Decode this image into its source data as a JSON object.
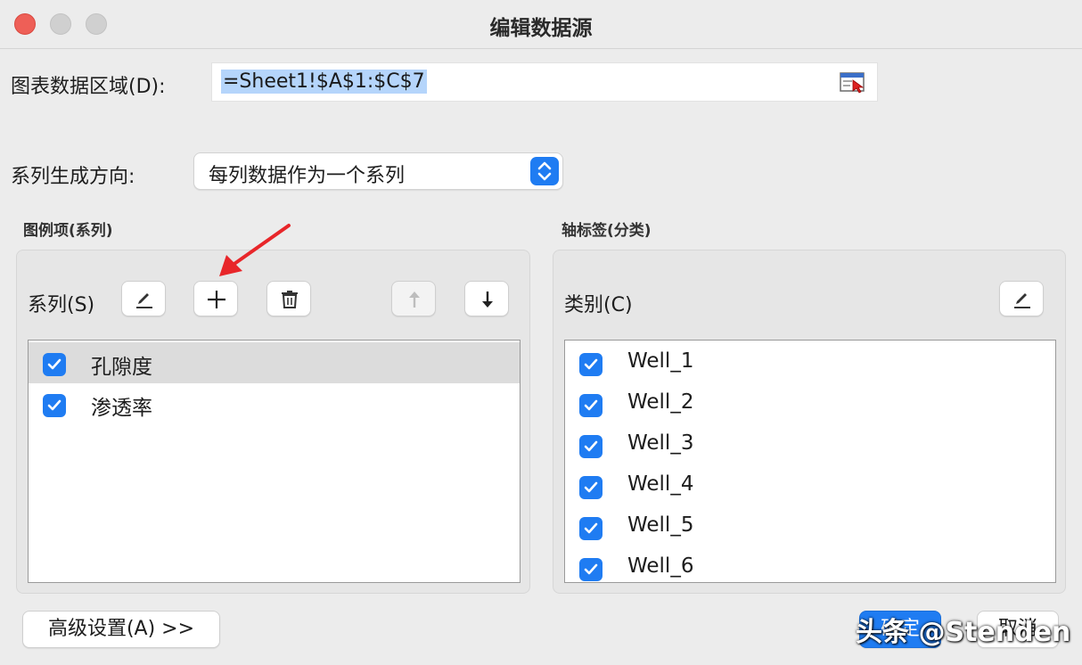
{
  "window": {
    "title": "编辑数据源"
  },
  "data_range": {
    "label": "图表数据区域(D):",
    "value": "=Sheet1!$A$1:$C$7",
    "picker_icon": "range-select-icon"
  },
  "series_direction": {
    "label": "系列生成方向:",
    "selected": "每列数据作为一个系列"
  },
  "legend_section": {
    "title": "图例项(系列)",
    "toolbar_label": "系列(S)",
    "items": [
      {
        "label": "孔隙度",
        "checked": true
      },
      {
        "label": "渗透率",
        "checked": true
      }
    ]
  },
  "axis_section": {
    "title": "轴标签(分类)",
    "toolbar_label": "类别(C)",
    "items": [
      {
        "label": "Well_1",
        "checked": true
      },
      {
        "label": "Well_2",
        "checked": true
      },
      {
        "label": "Well_3",
        "checked": true
      },
      {
        "label": "Well_4",
        "checked": true
      },
      {
        "label": "Well_5",
        "checked": true
      },
      {
        "label": "Well_6",
        "checked": true
      }
    ]
  },
  "footer": {
    "advanced_label": "高级设置(A) >>",
    "ok_label": "确定",
    "cancel_label": "取消"
  },
  "watermark": {
    "text": "头条 @Stenden"
  },
  "colors": {
    "accent": "#1f7cf2",
    "annotation_arrow": "#e8262a"
  }
}
